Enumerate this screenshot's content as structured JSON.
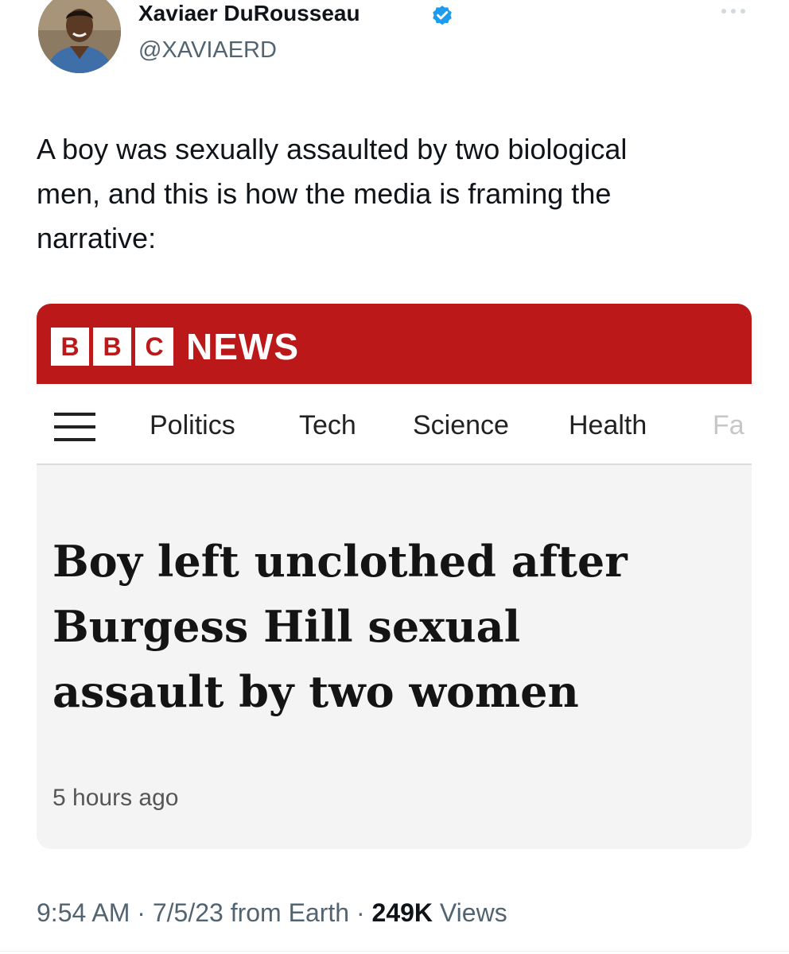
{
  "author": {
    "name": "Xaviaer DuRousseau",
    "handle": "@XAVIAERD",
    "verified": true
  },
  "tweet": {
    "text_lines": [
      "A boy was sexually assaulted by two biological",
      "men, and this is how the media is framing the",
      "narrative:"
    ],
    "time": "9:54 AM",
    "date": "7/5/23",
    "source": "from Earth",
    "views_count": "249K",
    "views_label": "Views",
    "separator": "·"
  },
  "article_card": {
    "brand_blocks": [
      "B",
      "B",
      "C"
    ],
    "brand_text": "NEWS",
    "nav_items": [
      "Politics",
      "Tech",
      "Science",
      "Health",
      "Fa"
    ],
    "headline_lines": [
      "Boy left unclothed after",
      "Burgess Hill sexual",
      "assault by two women"
    ],
    "timestamp": "5 hours ago"
  },
  "colors": {
    "bbc_red": "#bb1919",
    "verified_blue": "#1d9bf0",
    "secondary_text": "#536471",
    "card_background": "#f4f4f4"
  },
  "icons": {
    "verified": "verified-badge-icon",
    "more": "more-horizontal-icon",
    "menu": "hamburger-menu-icon"
  }
}
